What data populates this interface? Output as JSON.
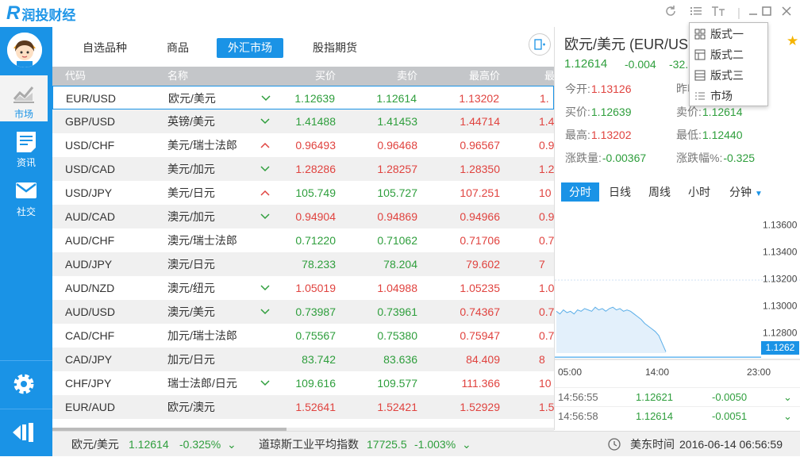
{
  "app": {
    "logo_mark": "R",
    "name_part1": "润投",
    "name_part2": "财经"
  },
  "sidebar": {
    "items": [
      {
        "label": "市场",
        "icon": "chart-icon",
        "active": true
      },
      {
        "label": "资讯",
        "icon": "news-icon",
        "active": false
      },
      {
        "label": "社交",
        "icon": "mail-icon",
        "active": false
      }
    ],
    "bottom": [
      {
        "icon": "settings-icon"
      },
      {
        "icon": "exit-icon"
      }
    ]
  },
  "tabs": [
    {
      "label": "自选品种",
      "active": false
    },
    {
      "label": "商品",
      "active": false
    },
    {
      "label": "外汇市场",
      "active": true
    },
    {
      "label": "股指期货",
      "active": false
    }
  ],
  "table": {
    "headers": [
      "代码",
      "名称",
      "买价",
      "卖价",
      "最高价",
      "最"
    ],
    "rows": [
      {
        "code": "EUR/USD",
        "name": "欧元/美元",
        "dir": "down",
        "buy": "1.12639",
        "sell": "1.12614",
        "high": "1.13202",
        "trunc": "1.",
        "buy_c": "down",
        "sell_c": "down",
        "high_c": "up"
      },
      {
        "code": "GBP/USD",
        "name": "英镑/美元",
        "dir": "down",
        "buy": "1.41488",
        "sell": "1.41453",
        "high": "1.44714",
        "trunc": "1.4",
        "buy_c": "down",
        "sell_c": "down",
        "high_c": "up"
      },
      {
        "code": "USD/CHF",
        "name": "美元/瑞士法郎",
        "dir": "up",
        "buy": "0.96493",
        "sell": "0.96468",
        "high": "0.96567",
        "trunc": "0.9",
        "buy_c": "up",
        "sell_c": "up",
        "high_c": "up"
      },
      {
        "code": "USD/CAD",
        "name": "美元/加元",
        "dir": "down",
        "buy": "1.28286",
        "sell": "1.28257",
        "high": "1.28350",
        "trunc": "1.2",
        "buy_c": "up",
        "sell_c": "up",
        "high_c": "up"
      },
      {
        "code": "USD/JPY",
        "name": "美元/日元",
        "dir": "up",
        "buy": "105.749",
        "sell": "105.727",
        "high": "107.251",
        "trunc": "10",
        "buy_c": "down",
        "sell_c": "down",
        "high_c": "up"
      },
      {
        "code": "AUD/CAD",
        "name": "澳元/加元",
        "dir": "down",
        "buy": "0.94904",
        "sell": "0.94869",
        "high": "0.94966",
        "trunc": "0.9",
        "buy_c": "up",
        "sell_c": "up",
        "high_c": "up"
      },
      {
        "code": "AUD/CHF",
        "name": "澳元/瑞士法郎",
        "dir": "",
        "buy": "0.71220",
        "sell": "0.71062",
        "high": "0.71706",
        "trunc": "0.7",
        "buy_c": "down",
        "sell_c": "down",
        "high_c": "up"
      },
      {
        "code": "AUD/JPY",
        "name": "澳元/日元",
        "dir": "",
        "buy": "78.233",
        "sell": "78.204",
        "high": "79.602",
        "trunc": "7",
        "buy_c": "down",
        "sell_c": "down",
        "high_c": "up"
      },
      {
        "code": "AUD/NZD",
        "name": "澳元/纽元",
        "dir": "down",
        "buy": "1.05019",
        "sell": "1.04988",
        "high": "1.05235",
        "trunc": "1.0",
        "buy_c": "up",
        "sell_c": "up",
        "high_c": "up"
      },
      {
        "code": "AUD/USD",
        "name": "澳元/美元",
        "dir": "down",
        "buy": "0.73987",
        "sell": "0.73961",
        "high": "0.74367",
        "trunc": "0.7",
        "buy_c": "down",
        "sell_c": "down",
        "high_c": "up"
      },
      {
        "code": "CAD/CHF",
        "name": "加元/瑞士法郎",
        "dir": "",
        "buy": "0.75567",
        "sell": "0.75380",
        "high": "0.75947",
        "trunc": "0.7",
        "buy_c": "down",
        "sell_c": "down",
        "high_c": "up"
      },
      {
        "code": "CAD/JPY",
        "name": "加元/日元",
        "dir": "",
        "buy": "83.742",
        "sell": "83.636",
        "high": "84.409",
        "trunc": "8",
        "buy_c": "down",
        "sell_c": "down",
        "high_c": "up"
      },
      {
        "code": "CHF/JPY",
        "name": "瑞士法郎/日元",
        "dir": "down",
        "buy": "109.616",
        "sell": "109.577",
        "high": "111.366",
        "trunc": "10",
        "buy_c": "down",
        "sell_c": "down",
        "high_c": "up"
      },
      {
        "code": "EUR/AUD",
        "name": "欧元/澳元",
        "dir": "",
        "buy": "1.52641",
        "sell": "1.52421",
        "high": "1.52929",
        "trunc": "1.5",
        "buy_c": "up",
        "sell_c": "up",
        "high_c": "up"
      }
    ]
  },
  "detail": {
    "title": "欧元/美元 (EUR/USD)",
    "price": "1.12614",
    "change": "-0.004",
    "change_pct": "-32.",
    "open_label": "今开:",
    "open_value": "1.13126",
    "prev_label": "昨收",
    "prev_value": "",
    "buy_label": "买价:",
    "buy_value": "1.12639",
    "sell_label": "卖价:",
    "sell_value": "1.12614",
    "high_label": "最高:",
    "high_value": "1.13202",
    "low_label": "最低:",
    "low_value": "1.12440",
    "chg_label": "涨跌量:",
    "chg_value": "-0.00367",
    "chgpct_label": "涨跌幅%:",
    "chgpct_value": "-0.325",
    "chart_tabs": [
      {
        "label": "分时",
        "active": true
      },
      {
        "label": "日线",
        "active": false
      },
      {
        "label": "周线",
        "active": false
      },
      {
        "label": "小时",
        "active": false
      },
      {
        "label": "分钟",
        "active": false
      }
    ],
    "current_price_tag": "1.1262",
    "trades": [
      {
        "time": "14:56:55",
        "price": "1.12621",
        "change": "-0.0050"
      },
      {
        "time": "14:56:58",
        "price": "1.12614",
        "change": "-0.0051"
      }
    ]
  },
  "chart_data": {
    "type": "area",
    "x_ticks": [
      "05:00",
      "14:00",
      "23:00"
    ],
    "y_ticks": [
      "1.13600",
      "1.13400",
      "1.13200",
      "1.13000",
      "1.12800"
    ],
    "ylim": [
      1.1265,
      1.1368
    ],
    "series": [
      {
        "values": [
          1.1296,
          1.1294,
          1.1297,
          1.1295,
          1.1296,
          1.1294,
          1.1297,
          1.1296,
          1.1298,
          1.1297,
          1.1296,
          1.1299,
          1.1297,
          1.1298,
          1.1296,
          1.1298,
          1.1299,
          1.1297,
          1.1298,
          1.1296,
          1.1297,
          1.1296,
          1.1294,
          1.1292,
          1.129,
          1.1287,
          1.1285,
          1.1283,
          1.1281,
          1.1278,
          1.1272,
          1.1266
        ]
      }
    ],
    "current": 1.1262
  },
  "dropdown": {
    "items": [
      {
        "label": "版式一",
        "icon": "layout-one-icon"
      },
      {
        "label": "版式二",
        "icon": "layout-two-icon"
      },
      {
        "label": "版式三",
        "icon": "layout-three-icon"
      },
      {
        "label": "市场",
        "icon": "list-icon"
      }
    ]
  },
  "statusbar": {
    "item1_name": "欧元/美元",
    "item1_price": "1.12614",
    "item1_pct": "-0.325%",
    "item2_name": "道琼斯工业平均指数",
    "item2_price": "17725.5",
    "item2_pct": "-1.003%",
    "time_label": "美东时间",
    "time_value": "2016-06-14 06:56:59"
  },
  "colors": {
    "accent": "#1a93e6",
    "up": "#e0433f",
    "down": "#2e9e3c"
  }
}
